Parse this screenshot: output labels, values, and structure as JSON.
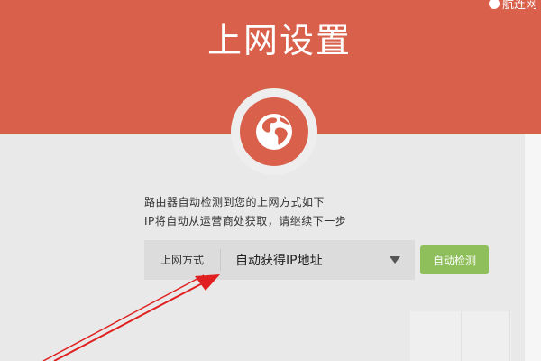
{
  "header": {
    "title": "上网设置",
    "corner_logo": "航连网"
  },
  "globe": {
    "icon": "globe-icon"
  },
  "info": {
    "line1": "路由器自动检测到您的上网方式如下",
    "line2": "IP将自动从运营商处获取，请继续下一步"
  },
  "connection": {
    "label": "上网方式",
    "value": "自动获得IP地址"
  },
  "detect_button": {
    "label": "自动检测"
  },
  "colors": {
    "header": "#d9604a",
    "background": "#e9e9e9",
    "button": "#8fbf5a",
    "arrow": "#e02020"
  }
}
